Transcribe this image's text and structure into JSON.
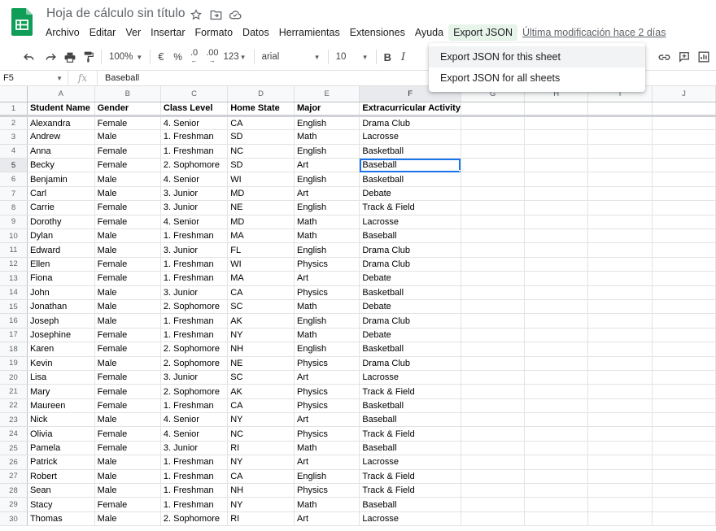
{
  "app": {
    "title": "Hoja de cálculo sin título",
    "icons": [
      "star-icon",
      "move-folder-icon",
      "cloud-status-icon"
    ]
  },
  "menu": {
    "items": [
      "Archivo",
      "Editar",
      "Ver",
      "Insertar",
      "Formato",
      "Datos",
      "Herramientas",
      "Extensiones",
      "Ayuda",
      "Export JSON"
    ],
    "active": "Export JSON",
    "last_edit": "Última modificación hace 2 días"
  },
  "toolbar": {
    "zoom": "100%",
    "currency": "€",
    "percent": "%",
    "decrease_decimals": ".0",
    "increase_decimals": ".00",
    "more_formats": "123",
    "font": "arial",
    "font_size": "10",
    "bold": "B",
    "italic": "I"
  },
  "formula_bar": {
    "name_box": "F5",
    "fx": "fx",
    "value": "Baseball"
  },
  "dropdown": {
    "items": [
      "Export JSON for this sheet",
      "Export JSON for all sheets"
    ]
  },
  "grid": {
    "columns": [
      "A",
      "B",
      "C",
      "D",
      "E",
      "F",
      "G",
      "H",
      "I",
      "J"
    ],
    "selected_column": "F",
    "selected_row": "5",
    "row_numbers": [
      "1",
      "2",
      "3",
      "4",
      "5",
      "6",
      "7",
      "8",
      "9",
      "10",
      "11",
      "12",
      "13",
      "14",
      "15",
      "16",
      "17",
      "18",
      "19",
      "20",
      "21",
      "22",
      "23",
      "24",
      "25",
      "26",
      "27",
      "28",
      "29",
      "30"
    ],
    "header": [
      "Student Name",
      "Gender",
      "Class Level",
      "Home State",
      "Major",
      "Extracurricular Activity"
    ],
    "rows": [
      [
        "Alexandra",
        "Female",
        "4. Senior",
        "CA",
        "English",
        "Drama Club"
      ],
      [
        "Andrew",
        "Male",
        "1. Freshman",
        "SD",
        "Math",
        "Lacrosse"
      ],
      [
        "Anna",
        "Female",
        "1. Freshman",
        "NC",
        "English",
        "Basketball"
      ],
      [
        "Becky",
        "Female",
        "2. Sophomore",
        "SD",
        "Art",
        "Baseball"
      ],
      [
        "Benjamin",
        "Male",
        "4. Senior",
        "WI",
        "English",
        "Basketball"
      ],
      [
        "Carl",
        "Male",
        "3. Junior",
        "MD",
        "Art",
        "Debate"
      ],
      [
        "Carrie",
        "Female",
        "3. Junior",
        "NE",
        "English",
        "Track & Field"
      ],
      [
        "Dorothy",
        "Female",
        "4. Senior",
        "MD",
        "Math",
        "Lacrosse"
      ],
      [
        "Dylan",
        "Male",
        "1. Freshman",
        "MA",
        "Math",
        "Baseball"
      ],
      [
        "Edward",
        "Male",
        "3. Junior",
        "FL",
        "English",
        "Drama Club"
      ],
      [
        "Ellen",
        "Female",
        "1. Freshman",
        "WI",
        "Physics",
        "Drama Club"
      ],
      [
        "Fiona",
        "Female",
        "1. Freshman",
        "MA",
        "Art",
        "Debate"
      ],
      [
        "John",
        "Male",
        "3. Junior",
        "CA",
        "Physics",
        "Basketball"
      ],
      [
        "Jonathan",
        "Male",
        "2. Sophomore",
        "SC",
        "Math",
        "Debate"
      ],
      [
        "Joseph",
        "Male",
        "1. Freshman",
        "AK",
        "English",
        "Drama Club"
      ],
      [
        "Josephine",
        "Female",
        "1. Freshman",
        "NY",
        "Math",
        "Debate"
      ],
      [
        "Karen",
        "Female",
        "2. Sophomore",
        "NH",
        "English",
        "Basketball"
      ],
      [
        "Kevin",
        "Male",
        "2. Sophomore",
        "NE",
        "Physics",
        "Drama Club"
      ],
      [
        "Lisa",
        "Female",
        "3. Junior",
        "SC",
        "Art",
        "Lacrosse"
      ],
      [
        "Mary",
        "Female",
        "2. Sophomore",
        "AK",
        "Physics",
        "Track & Field"
      ],
      [
        "Maureen",
        "Female",
        "1. Freshman",
        "CA",
        "Physics",
        "Basketball"
      ],
      [
        "Nick",
        "Male",
        "4. Senior",
        "NY",
        "Art",
        "Baseball"
      ],
      [
        "Olivia",
        "Female",
        "4. Senior",
        "NC",
        "Physics",
        "Track & Field"
      ],
      [
        "Pamela",
        "Female",
        "3. Junior",
        "RI",
        "Math",
        "Baseball"
      ],
      [
        "Patrick",
        "Male",
        "1. Freshman",
        "NY",
        "Art",
        "Lacrosse"
      ],
      [
        "Robert",
        "Male",
        "1. Freshman",
        "CA",
        "English",
        "Track & Field"
      ],
      [
        "Sean",
        "Male",
        "1. Freshman",
        "NH",
        "Physics",
        "Track & Field"
      ],
      [
        "Stacy",
        "Female",
        "1. Freshman",
        "NY",
        "Math",
        "Baseball"
      ],
      [
        "Thomas",
        "Male",
        "2. Sophomore",
        "RI",
        "Art",
        "Lacrosse"
      ]
    ]
  },
  "colors": {
    "accent": "#1a73e8",
    "menu_active_bg": "#e6f4ea",
    "logo_green": "#0f9d58"
  }
}
